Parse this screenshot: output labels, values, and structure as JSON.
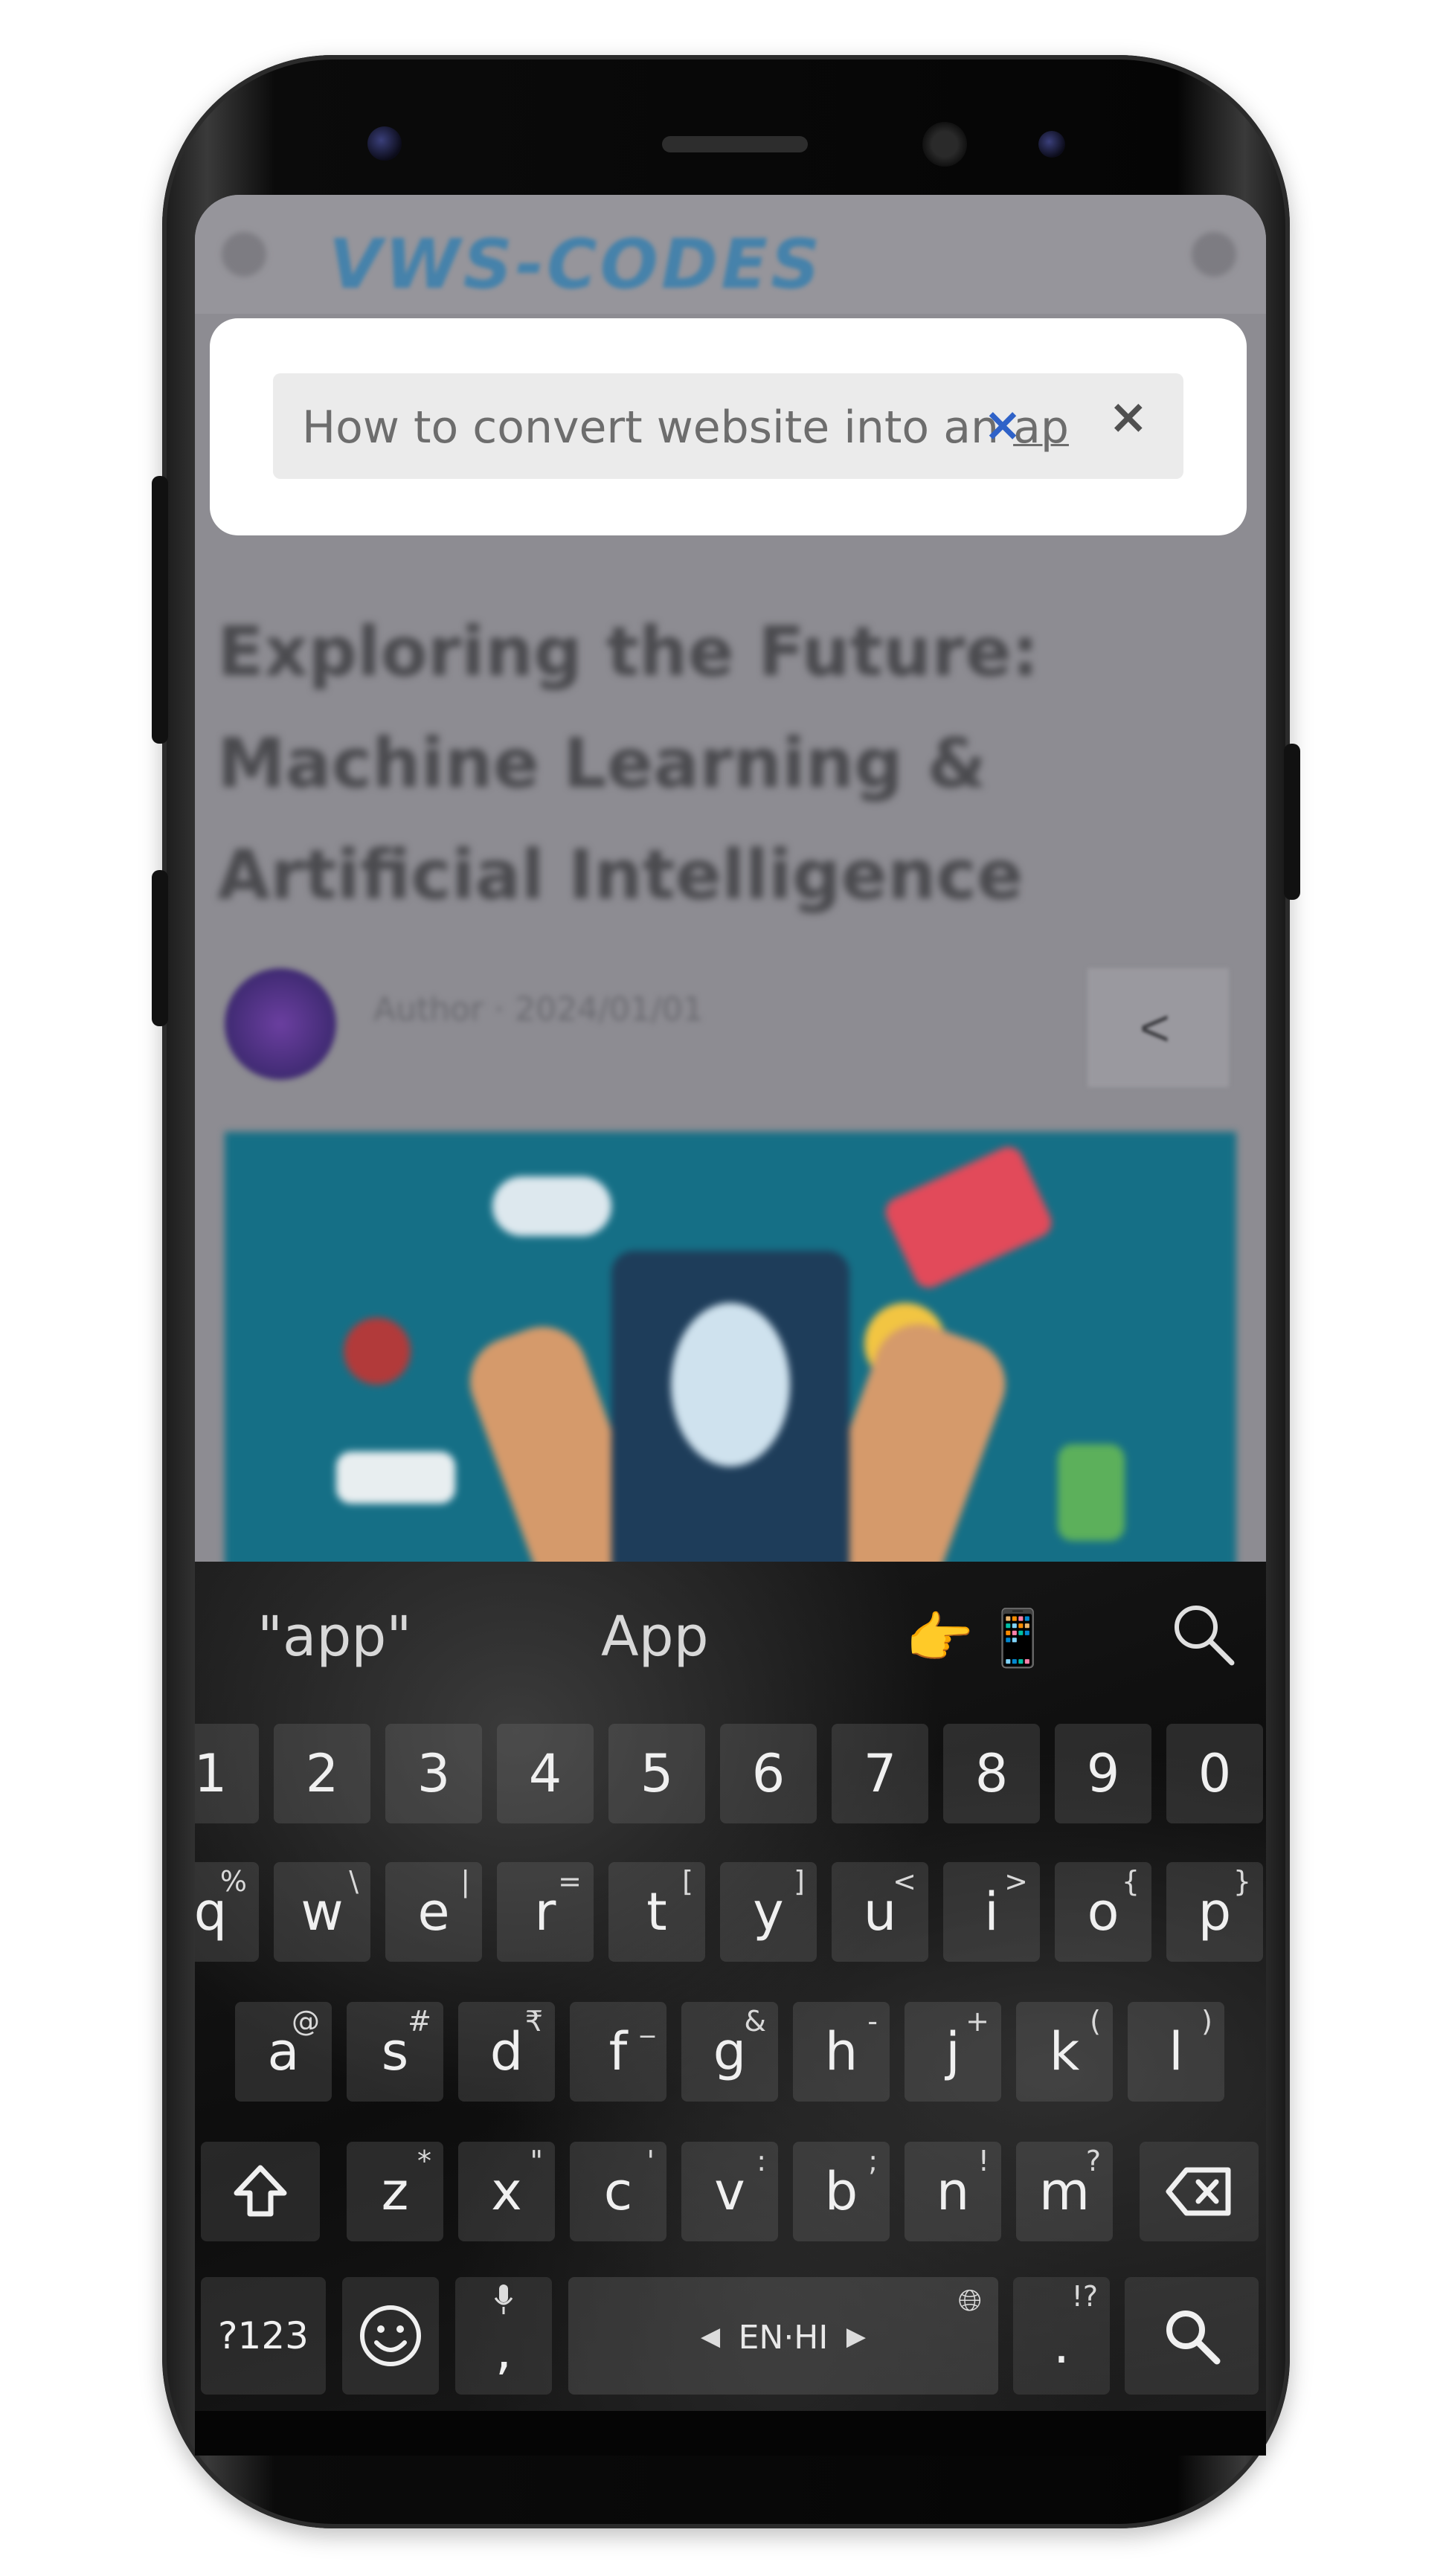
{
  "website": {
    "logo": "VWS-CODES",
    "article_title": "Exploring the Future: Machine Learning & Artificial Intelligence",
    "author_meta": "Author · 2024/01/01",
    "share_icon": "share-icon"
  },
  "search_dialog": {
    "query_prefix": "How to convert website into an ",
    "query_typed": "ap",
    "clear_icon": "×",
    "close_icon": "×"
  },
  "keyboard": {
    "suggestions": [
      "\"app\"",
      "App"
    ],
    "emoji_suggestions": [
      "👉",
      "📱"
    ],
    "number_row": [
      "1",
      "2",
      "3",
      "4",
      "5",
      "6",
      "7",
      "8",
      "9",
      "0"
    ],
    "row1": [
      {
        "key": "q",
        "hint": "%"
      },
      {
        "key": "w",
        "hint": "\\"
      },
      {
        "key": "e",
        "hint": "|"
      },
      {
        "key": "r",
        "hint": "="
      },
      {
        "key": "t",
        "hint": "["
      },
      {
        "key": "y",
        "hint": "]"
      },
      {
        "key": "u",
        "hint": "<"
      },
      {
        "key": "i",
        "hint": ">"
      },
      {
        "key": "o",
        "hint": "{"
      },
      {
        "key": "p",
        "hint": "}"
      }
    ],
    "row2": [
      {
        "key": "a",
        "hint": "@"
      },
      {
        "key": "s",
        "hint": "#"
      },
      {
        "key": "d",
        "hint": "₹"
      },
      {
        "key": "f",
        "hint": "_"
      },
      {
        "key": "g",
        "hint": "&"
      },
      {
        "key": "h",
        "hint": "-"
      },
      {
        "key": "j",
        "hint": "+"
      },
      {
        "key": "k",
        "hint": "("
      },
      {
        "key": "l",
        "hint": ")"
      }
    ],
    "row3": [
      {
        "key": "z",
        "hint": "*"
      },
      {
        "key": "x",
        "hint": "\""
      },
      {
        "key": "c",
        "hint": "'"
      },
      {
        "key": "v",
        "hint": ":"
      },
      {
        "key": "b",
        "hint": ";"
      },
      {
        "key": "n",
        "hint": "!"
      },
      {
        "key": "m",
        "hint": "?"
      }
    ],
    "shift_icon": "shift-icon",
    "backspace_icon": "backspace-icon",
    "symbols_label": "?123",
    "comma_label": ",",
    "space_label": "EN·HI",
    "period_label": ".",
    "period_hint": "!?",
    "search_key_icon": "search-icon",
    "emoji_key_icon": "emoji-icon",
    "mic_icon": "mic-icon",
    "globe_icon": "globe-icon"
  }
}
